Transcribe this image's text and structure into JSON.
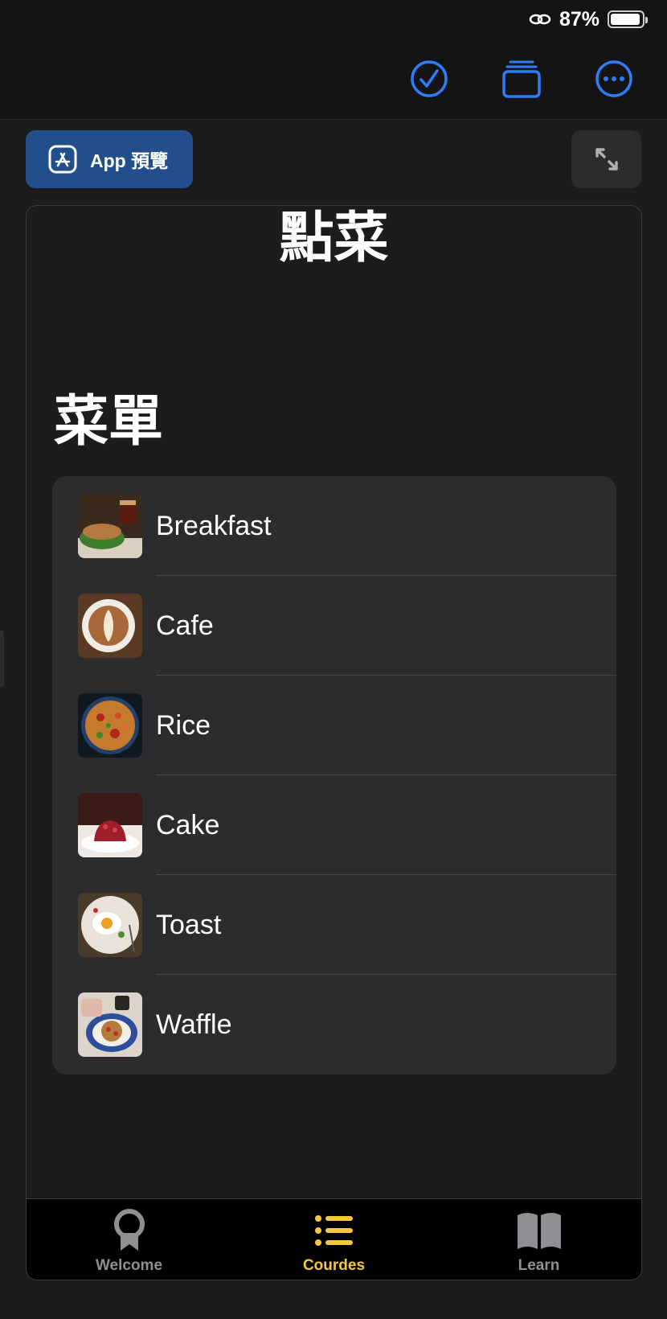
{
  "status_bar": {
    "battery": "87%",
    "battery_level": 0.87
  },
  "toolbar": {
    "icons": [
      "checkmark-circle-icon",
      "stack-icon",
      "more-circle-icon"
    ],
    "accent": "#2f7df6"
  },
  "preview_button": {
    "label": "App 預覽",
    "color": "#234e8c"
  },
  "app": {
    "nav_title": "點菜",
    "large_title": "菜單",
    "menu": [
      {
        "label": "Breakfast"
      },
      {
        "label": "Cafe"
      },
      {
        "label": "Rice"
      },
      {
        "label": "Cake"
      },
      {
        "label": "Toast"
      },
      {
        "label": "Waffle"
      }
    ],
    "tabs": [
      {
        "label": "Welcome",
        "icon": "award-ribbon-icon",
        "selected": false
      },
      {
        "label": "Courdes",
        "icon": "list-icon",
        "selected": true
      },
      {
        "label": "Learn",
        "icon": "book-icon",
        "selected": false
      }
    ],
    "tab_active_color": "#f5c842",
    "tab_inactive_color": "#8e8e93"
  }
}
